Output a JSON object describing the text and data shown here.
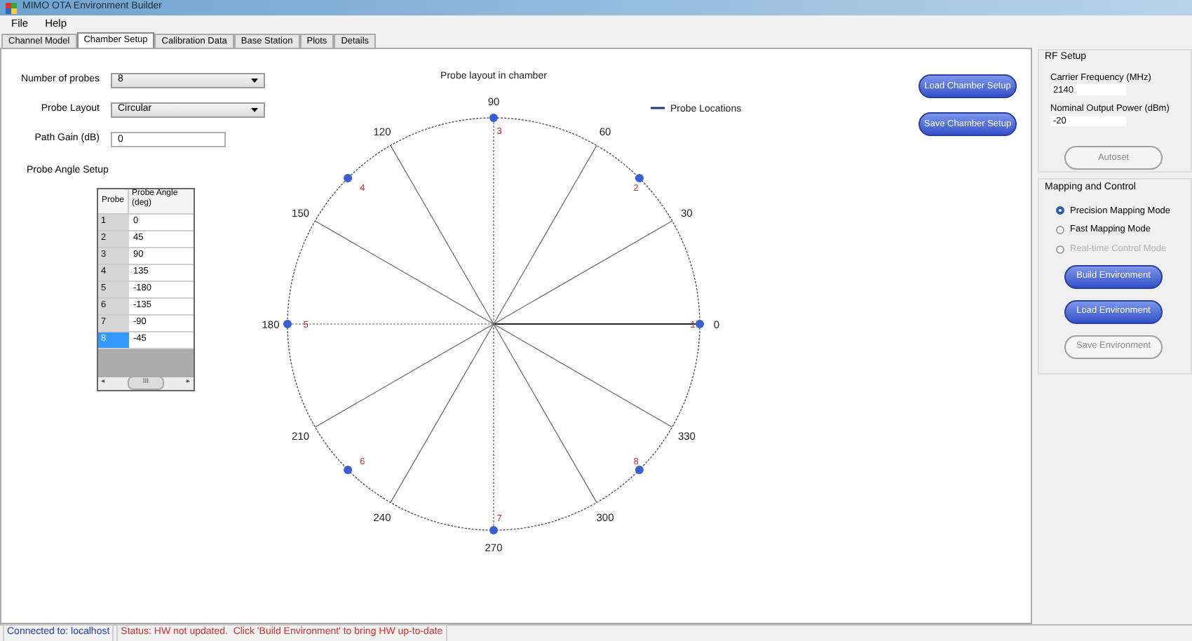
{
  "window": {
    "title": "MIMO OTA Environment Builder"
  },
  "menu": [
    "File",
    "Help"
  ],
  "tabs": [
    {
      "label": "Channel Model",
      "selected": false
    },
    {
      "label": "Chamber Setup",
      "selected": true
    },
    {
      "label": "Calibration Data",
      "selected": false
    },
    {
      "label": "Base Station",
      "selected": false
    },
    {
      "label": "Plots",
      "selected": false
    },
    {
      "label": "Details",
      "selected": false
    }
  ],
  "settings": {
    "probe_count": {
      "label": "Number of probes",
      "value": "8"
    },
    "probe_layout": {
      "label": "Probe Layout",
      "value": "Circular"
    },
    "path_gain": {
      "label": "Path Gain (dB)",
      "value": "0"
    }
  },
  "probe_table": {
    "title": "Probe Angle Setup",
    "columns": [
      "Probe",
      "Probe Angle (deg)"
    ],
    "rows": [
      {
        "probe": "1",
        "angle": "0",
        "selected": false
      },
      {
        "probe": "2",
        "angle": "45",
        "selected": false
      },
      {
        "probe": "3",
        "angle": "90",
        "selected": false
      },
      {
        "probe": "4",
        "angle": "135",
        "selected": false
      },
      {
        "probe": "5",
        "angle": "-180",
        "selected": false
      },
      {
        "probe": "6",
        "angle": "-135",
        "selected": false
      },
      {
        "probe": "7",
        "angle": "-90",
        "selected": false
      },
      {
        "probe": "8",
        "angle": "-45",
        "selected": true
      }
    ],
    "scroll_mark": "III",
    "scroll_left": "◂",
    "scroll_right": "▸"
  },
  "chart": {
    "title": "Probe layout in chamber",
    "probe_labels": [
      "1",
      "2",
      "3",
      "4",
      "5",
      "6",
      "7",
      "8"
    ],
    "legend": "Probe Locations",
    "angle_labels": [
      "0",
      "30",
      "60",
      "90",
      "120",
      "150",
      "180",
      "210",
      "240",
      "270",
      "300",
      "330"
    ]
  },
  "chamber_buttons": [
    "Load Chamber Setup",
    "Save Chamber Setup"
  ],
  "rf_setup": {
    "title": "RF Setup",
    "carrier_frequency": {
      "label": "Carrier Frequency (MHz)",
      "value": "2140"
    },
    "output_power": {
      "label": "Nominal Output Power (dBm)",
      "value": "-20"
    },
    "autoset": {
      "label": "Autoset",
      "disabled": true
    }
  },
  "mapping": {
    "title": "Mapping and Control",
    "modes": [
      {
        "label": "Precision Mapping Mode",
        "selected": true,
        "disabled": false
      },
      {
        "label": "Fast Mapping Mode",
        "selected": false,
        "disabled": false
      },
      {
        "label": "Real-time Control Mode",
        "selected": false,
        "disabled": true
      }
    ],
    "buttons": [
      {
        "label": "Build Environment",
        "disabled": false
      },
      {
        "label": "Load Environment",
        "disabled": false
      },
      {
        "label": "Save Environment",
        "disabled": true
      }
    ]
  },
  "status_bar": {
    "connection": "Connected to: localhost",
    "status": "Status: HW not updated.  Click 'Build Environment' to bring HW up-to-date"
  }
}
